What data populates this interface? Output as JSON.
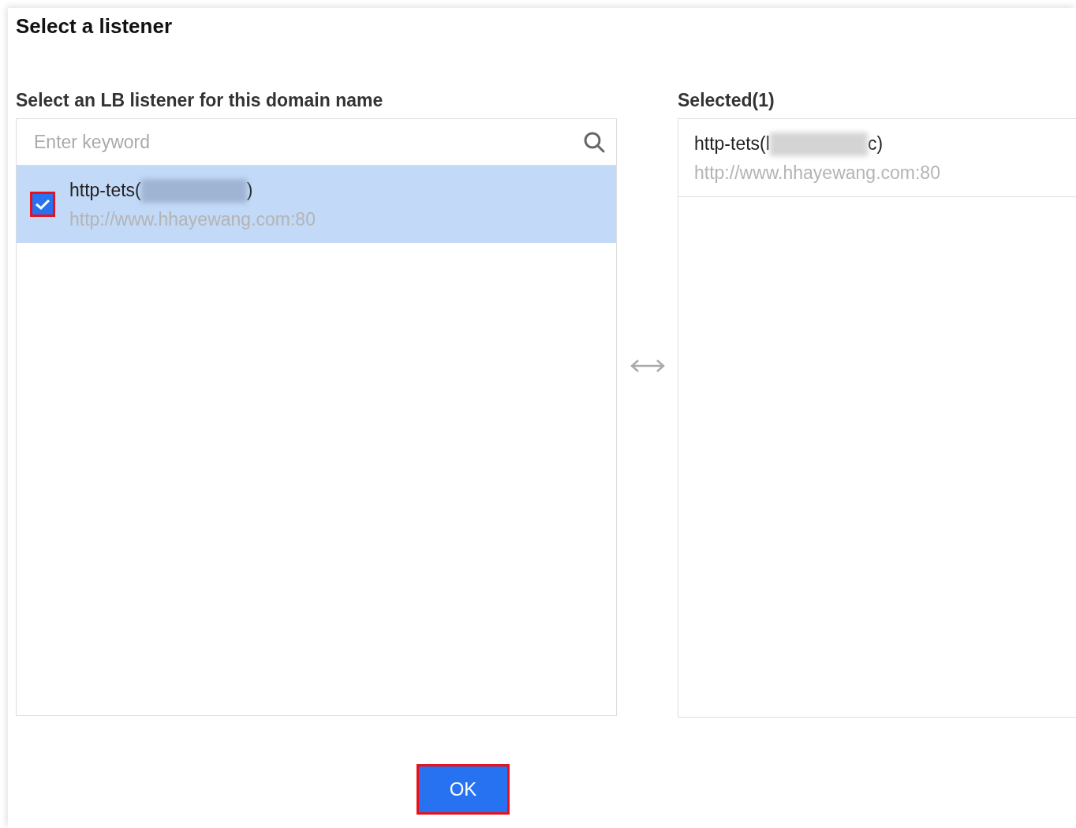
{
  "dialog": {
    "title": "Select a listener"
  },
  "source": {
    "heading": "Select an LB listener for this domain name",
    "search": {
      "placeholder": "Enter keyword"
    },
    "items": [
      {
        "name_start": "http-tets(",
        "name_end": ")",
        "url": "http://www.hhayewang.com:80",
        "checked": true,
        "selected": true,
        "highlighted": true
      }
    ]
  },
  "target": {
    "heading": "Selected(1)",
    "items": [
      {
        "name_start": "http-tets(l",
        "name_end": "c)",
        "url": "http://www.hhayewang.com:80"
      }
    ]
  },
  "ok_button": {
    "label": "OK",
    "highlighted": true
  }
}
